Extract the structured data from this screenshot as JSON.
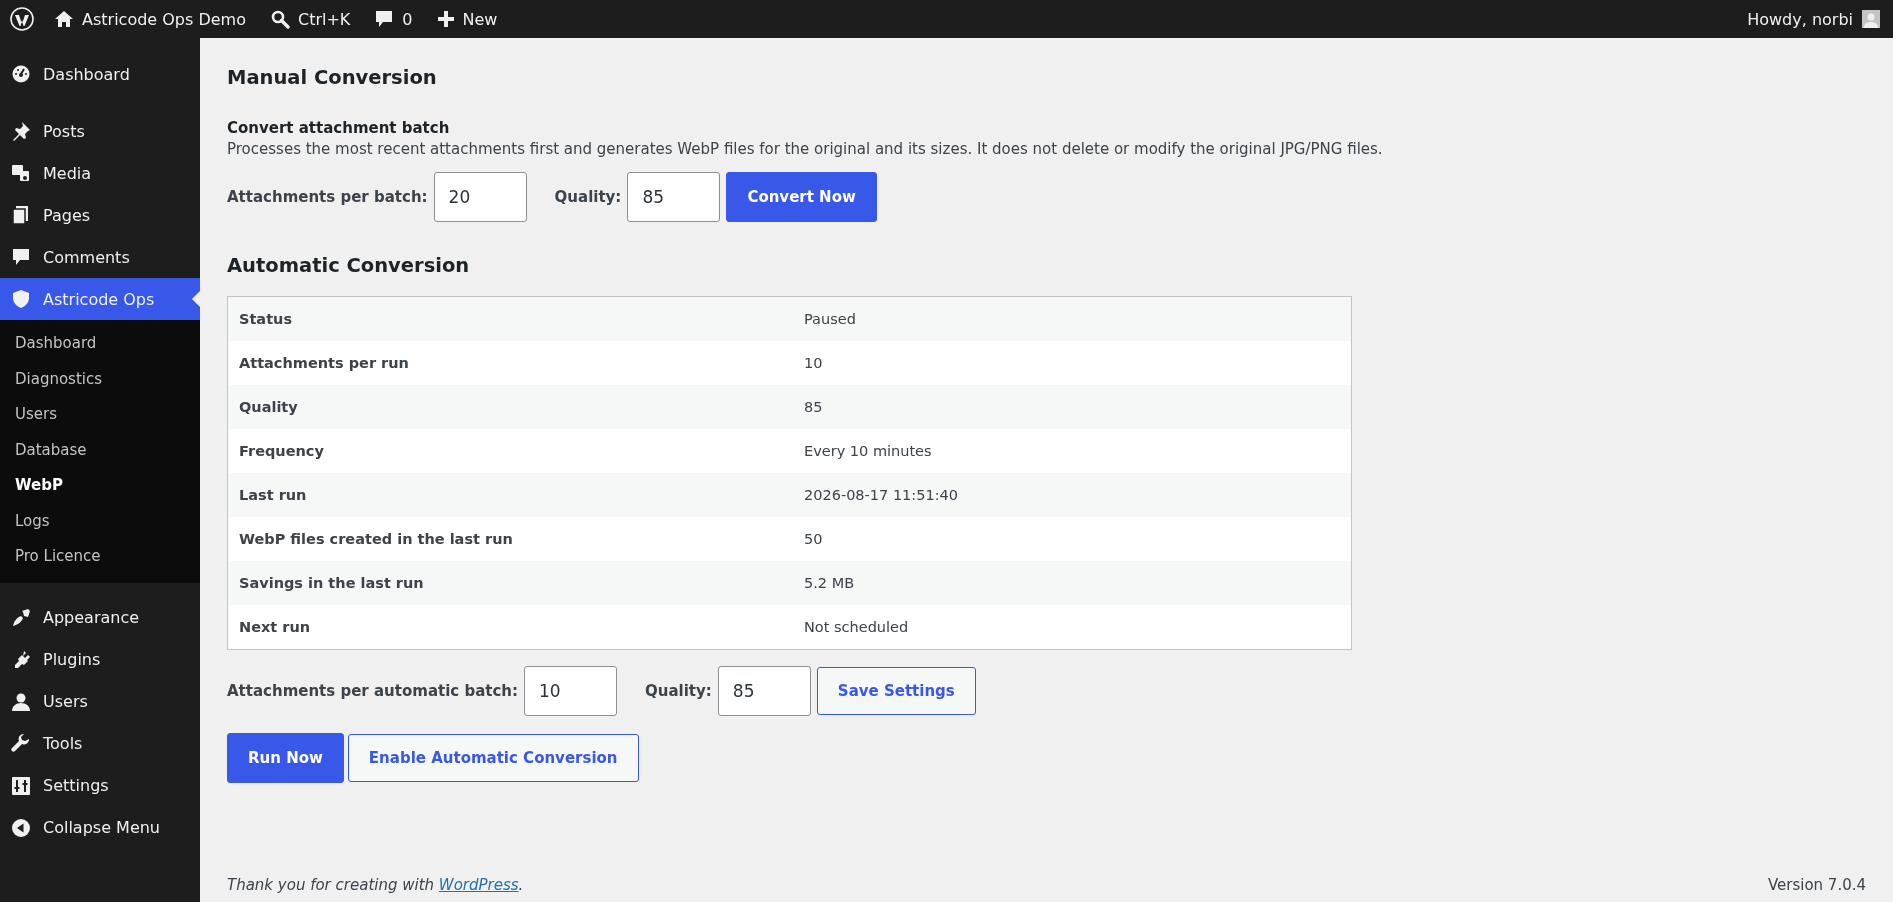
{
  "admin_bar": {
    "site_name": "Astricode Ops Demo",
    "search_shortcut": "Ctrl+K",
    "comments_count": "0",
    "new_label": "New",
    "greeting": "Howdy, norbi"
  },
  "sidebar": {
    "items": [
      {
        "label": "Dashboard",
        "selected": false
      },
      {
        "label": "Posts",
        "selected": false
      },
      {
        "label": "Media",
        "selected": false
      },
      {
        "label": "Pages",
        "selected": false
      },
      {
        "label": "Comments",
        "selected": false
      },
      {
        "label": "Astricode Ops",
        "selected": true,
        "children": [
          {
            "label": "Dashboard",
            "selected": false
          },
          {
            "label": "Diagnostics",
            "selected": false
          },
          {
            "label": "Users",
            "selected": false
          },
          {
            "label": "Database",
            "selected": false
          },
          {
            "label": "WebP",
            "selected": true
          },
          {
            "label": "Logs",
            "selected": false
          },
          {
            "label": "Pro Licence",
            "selected": false
          }
        ]
      },
      {
        "label": "Appearance",
        "selected": false
      },
      {
        "label": "Plugins",
        "selected": false
      },
      {
        "label": "Users",
        "selected": false
      },
      {
        "label": "Tools",
        "selected": false
      },
      {
        "label": "Settings",
        "selected": false
      }
    ],
    "collapse_label": "Collapse Menu"
  },
  "manual": {
    "title": "Manual Conversion",
    "subtitle": "Convert attachment batch",
    "description": "Processes the most recent attachments first and generates WebP files for the original and its sizes. It does not delete or modify the original JPG/PNG files.",
    "fields": [
      {
        "label": "Attachments per batch:",
        "value": "20"
      },
      {
        "label": "Quality:",
        "value": "85"
      }
    ],
    "buttons": [
      {
        "label": "Convert Now",
        "kind": "primary"
      }
    ]
  },
  "automatic": {
    "title": "Automatic Conversion",
    "table": {
      "rows": [
        {
          "label": "Status",
          "value": "Paused"
        },
        {
          "label": "Attachments per run",
          "value": "10"
        },
        {
          "label": "Quality",
          "value": "85"
        },
        {
          "label": "Frequency",
          "value": "Every 10 minutes"
        },
        {
          "label": "Last run",
          "value": "2026-08-17 11:51:40"
        },
        {
          "label": "WebP files created in the last run",
          "value": "50"
        },
        {
          "label": "Savings in the last run",
          "value": "5.2 MB"
        },
        {
          "label": "Next run",
          "value": "Not scheduled"
        }
      ]
    },
    "fields": [
      {
        "label": "Attachments per automatic batch:",
        "value": "10"
      },
      {
        "label": "Quality:",
        "value": "85"
      }
    ],
    "buttons": [
      {
        "label": "Save Settings",
        "kind": "secondary"
      }
    ],
    "actions": [
      {
        "label": "Run Now",
        "kind": "primary"
      },
      {
        "label": "Enable Automatic Conversion",
        "kind": "secondary"
      }
    ]
  },
  "footer": {
    "text": "Thank you for creating with ",
    "link": "WordPress",
    "text_end": ".",
    "version": "Version 7.0.4"
  }
}
